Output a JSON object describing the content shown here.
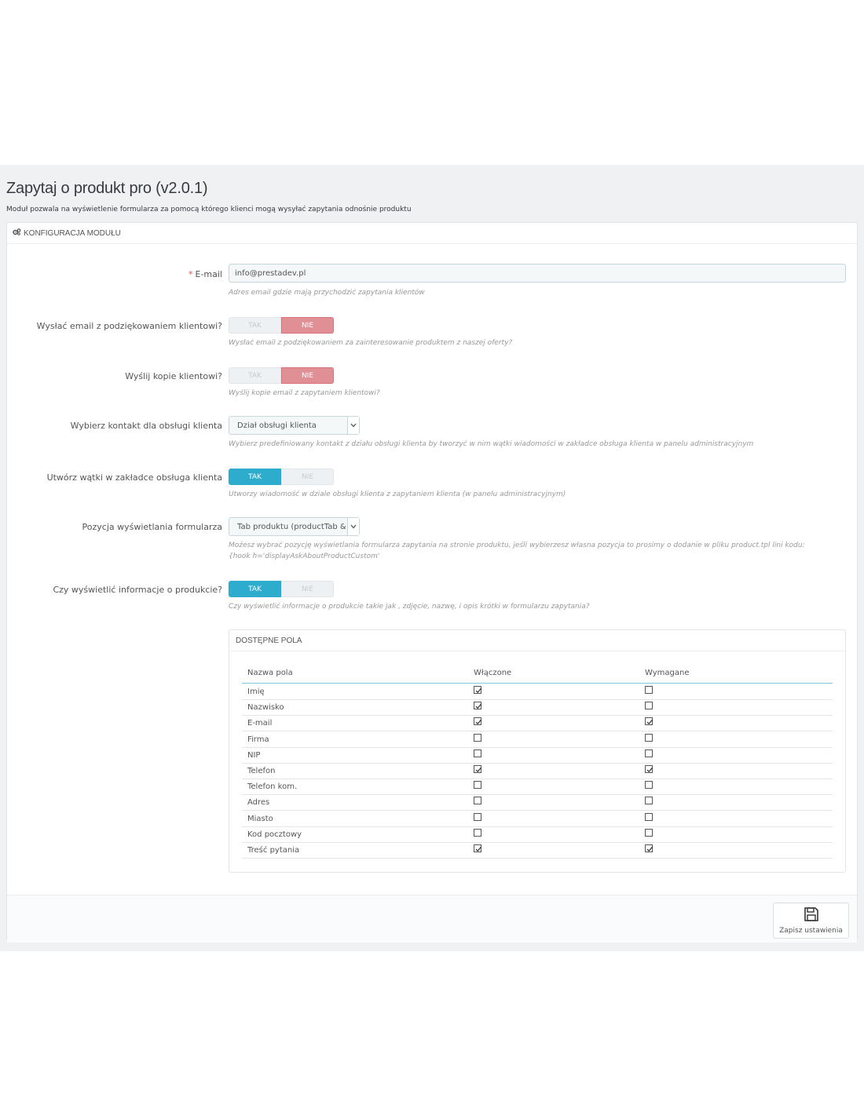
{
  "header": {
    "title": "Zapytaj o produkt pro (v2.0.1)",
    "description": "Moduł pozwala na wyświetlenie formularza za pomocą którego klienci mogą wysyłać zapytania odnośnie produktu"
  },
  "panel": {
    "title": "KONFIGURACJA MODUŁU",
    "icon": "cogs-icon"
  },
  "form": {
    "email": {
      "required_mark": "*",
      "label": "E-mail",
      "value": "info@prestadev.pl",
      "help": "Adres email gdzie mają przychodzić zapytania klientów"
    },
    "thanks_email": {
      "label": "Wysłać email z podziękowaniem klientowi?",
      "yes": "TAK",
      "no": "NIE",
      "selected": "NIE",
      "help": "Wysłać email z podziękowaniem za zainteresowanie produktem z naszej oferty?"
    },
    "copy_to_client": {
      "label": "Wyślij kopie klientowi?",
      "yes": "TAK",
      "no": "NIE",
      "selected": "NIE",
      "help": "Wyślij kopie email z zapytaniem klientowi?"
    },
    "contact": {
      "label": "Wybierz kontakt dla obsługi klienta",
      "value": "Dział obsługi klienta",
      "help": "Wybierz predefiniowany kontakt z działu obsługi klienta by tworzyć w nim wątki wiadomości w zakładce obsługa klienta w panelu administracyjnym"
    },
    "create_threads": {
      "label": "Utwórz wątki w zakładce obsługa klienta",
      "yes": "TAK",
      "no": "NIE",
      "selected": "TAK",
      "help": "Utworzy wiadomość w dziale obsługi klienta z zapytaniem klienta (w panelu administracyjnym)"
    },
    "position": {
      "label": "Pozycja wyświetlania formularza",
      "value": "Tab produktu (productTab &",
      "help_line1": "Możesz wybrać pozycję wyświetlania formularza zapytania na stronie produktu, jeśli wybierzesz własna pozycja to prosimy o dodanie w pliku product.tpl lini kodu:",
      "help_line2": "{hook h='displayAskAboutProductCustom'"
    },
    "show_product_info": {
      "label": "Czy wyświetlić informacje o produkcie?",
      "yes": "TAK",
      "no": "NIE",
      "selected": "TAK",
      "help": "Czy wyświetlić informacje o produkcie takie jak , zdjęcie, nazwę, i opis krótki w formularzu zapytania?"
    }
  },
  "fields": {
    "title": "DOSTĘPNE POLA",
    "columns": [
      "Nazwa pola",
      "Włączone",
      "Wymagane"
    ],
    "rows": [
      {
        "name": "Imię",
        "enabled": true,
        "required": false
      },
      {
        "name": "Nazwisko",
        "enabled": true,
        "required": false
      },
      {
        "name": "E-mail",
        "enabled": true,
        "required": true
      },
      {
        "name": "Firma",
        "enabled": false,
        "required": false
      },
      {
        "name": "NIP",
        "enabled": false,
        "required": false
      },
      {
        "name": "Telefon",
        "enabled": true,
        "required": true
      },
      {
        "name": "Telefon kom.",
        "enabled": false,
        "required": false
      },
      {
        "name": "Adres",
        "enabled": false,
        "required": false
      },
      {
        "name": "Miasto",
        "enabled": false,
        "required": false
      },
      {
        "name": "Kod pocztowy",
        "enabled": false,
        "required": false
      },
      {
        "name": "Treść pytania",
        "enabled": true,
        "required": true
      }
    ]
  },
  "footer": {
    "save_label": "Zapisz ustawienia",
    "save_icon": "floppy-disk-icon"
  },
  "colors": {
    "accent": "#2eacce",
    "no_active": "#e08f95",
    "required": "#e2534b"
  }
}
